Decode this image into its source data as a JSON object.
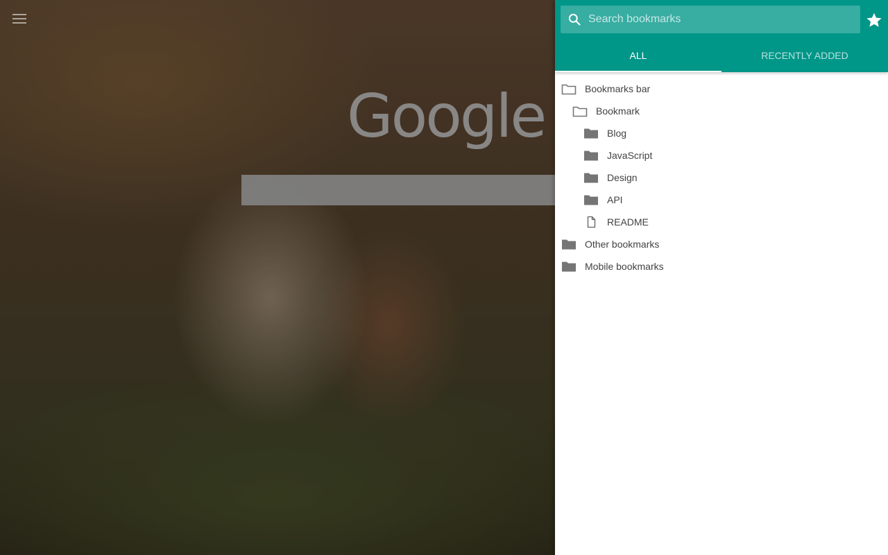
{
  "background": {
    "logo_text": "Google"
  },
  "panel": {
    "accent_color": "#009688",
    "search": {
      "placeholder": "Search bookmarks",
      "value": ""
    },
    "tabs": [
      {
        "label": "ALL",
        "active": true
      },
      {
        "label": "RECENTLY ADDED",
        "active": false
      }
    ],
    "tree": [
      {
        "label": "Bookmarks bar",
        "icon": "folder-open-icon"
      },
      {
        "label": "Bookmark",
        "icon": "folder-open-icon"
      },
      {
        "label": "Blog",
        "icon": "folder-icon"
      },
      {
        "label": "JavaScript",
        "icon": "folder-icon"
      },
      {
        "label": "Design",
        "icon": "folder-icon"
      },
      {
        "label": "API",
        "icon": "folder-icon"
      },
      {
        "label": "README",
        "icon": "file-icon"
      },
      {
        "label": "Other bookmarks",
        "icon": "folder-icon"
      },
      {
        "label": "Mobile bookmarks",
        "icon": "folder-icon"
      }
    ]
  }
}
